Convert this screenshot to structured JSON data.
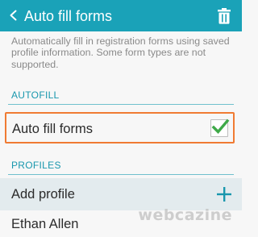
{
  "action_bar": {
    "title": "Auto fill forms",
    "back_icon": "chevron-left-icon",
    "delete_icon": "trash-icon",
    "background_color": "#1aa2b8"
  },
  "description": "Automatically fill in registration forms using saved profile information. Some form types are not supported.",
  "sections": {
    "autofill": {
      "header": "AUTOFILL",
      "item_label": "Auto fill forms",
      "checked": true,
      "check_color": "#3ea948",
      "highlight_color": "#f07b33"
    },
    "profiles": {
      "header": "PROFILES",
      "add_label": "Add profile",
      "add_icon": "plus-icon",
      "items": [
        {
          "name": "Ethan Allen"
        }
      ]
    }
  },
  "watermark": "webcazine",
  "accent_color": "#1897ad"
}
